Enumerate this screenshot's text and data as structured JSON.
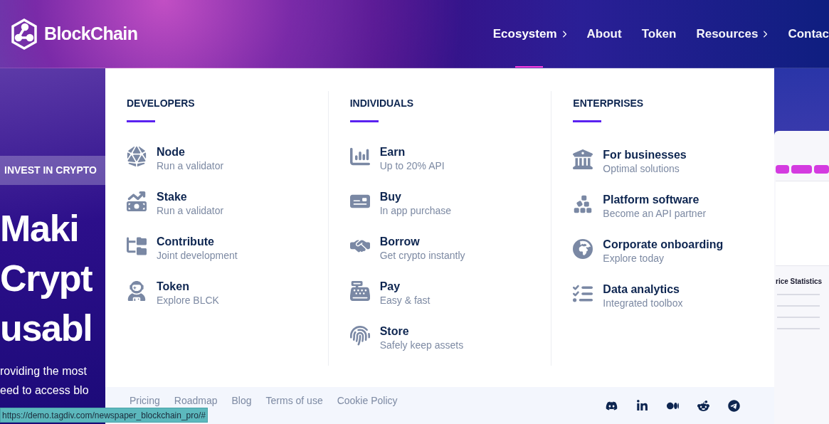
{
  "header": {
    "logo": "BlockChain",
    "nav": [
      {
        "label": "Ecosystem",
        "has_submenu": true,
        "selected": true
      },
      {
        "label": "About",
        "has_submenu": false,
        "selected": false
      },
      {
        "label": "Token",
        "has_submenu": false,
        "selected": false
      },
      {
        "label": "Resources",
        "has_submenu": true,
        "selected": false
      },
      {
        "label": "Contac",
        "has_submenu": false,
        "selected": false
      }
    ]
  },
  "hero": {
    "tag": "INVEST IN CRYPTO",
    "heading_lines": [
      "Maki",
      "Crypt",
      "usabl"
    ],
    "paragraph_lines": [
      "roviding the most",
      "eed to access blo"
    ]
  },
  "mega_menu": {
    "columns": [
      {
        "title": "DEVELOPERS",
        "items": [
          {
            "title": "Node",
            "subtitle": "Run a validator"
          },
          {
            "title": "Stake",
            "subtitle": "Run a validator"
          },
          {
            "title": "Contribute",
            "subtitle": "Joint development"
          },
          {
            "title": "Token",
            "subtitle": "Explore BLCK"
          }
        ]
      },
      {
        "title": "INDIVIDUALS",
        "items": [
          {
            "title": "Earn",
            "subtitle": "Up to 20% API"
          },
          {
            "title": "Buy",
            "subtitle": "In app purchase"
          },
          {
            "title": "Borrow",
            "subtitle": "Get crypto instantly"
          },
          {
            "title": "Pay",
            "subtitle": "Easy & fast"
          },
          {
            "title": "Store",
            "subtitle": "Safely keep assets"
          }
        ]
      },
      {
        "title": "ENTERPRISES",
        "items": [
          {
            "title": "For businesses",
            "subtitle": "Optimal solutions"
          },
          {
            "title": "Platform software",
            "subtitle": "Become an API partner"
          },
          {
            "title": "Corporate onboarding",
            "subtitle": "Explore today"
          },
          {
            "title": "Data analytics",
            "subtitle": "Integrated toolbox"
          }
        ]
      }
    ],
    "footer_links": [
      "Pricing",
      "Roadmap",
      "Blog",
      "Terms of use",
      "Cookie Policy"
    ]
  },
  "preview": {
    "heading": "rice Statistics"
  },
  "status_bar": {
    "url": "https://demo.tagdiv.com/newspaper_blockchain_pro/#"
  }
}
